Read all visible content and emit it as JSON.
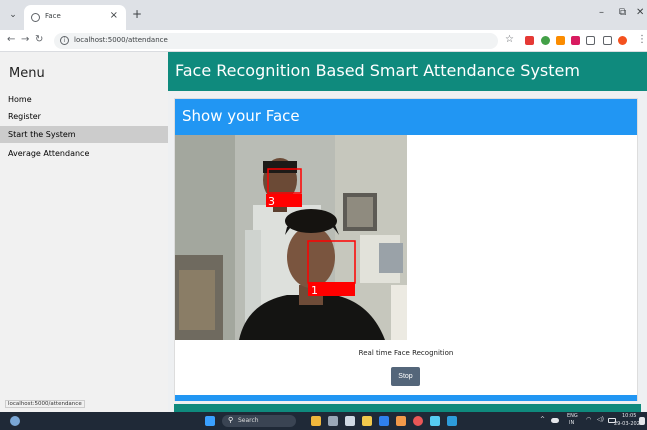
{
  "browser": {
    "tab_title": "Face",
    "tab_close": "×",
    "new_tab": "+",
    "url": "localhost:5000/attendance",
    "status_url": "localhost:5000/attendance"
  },
  "sidebar": {
    "title": "Menu",
    "items": [
      {
        "label": "Home"
      },
      {
        "label": "Register"
      },
      {
        "label": "Start the System"
      },
      {
        "label": "Average Attendance"
      }
    ]
  },
  "header": {
    "title": "Face Recognition Based Smart Attendance System"
  },
  "card": {
    "title": "Show your Face",
    "caption": "Real time Face Recognition",
    "stop_label": "Stop"
  },
  "video": {
    "faces": [
      {
        "label": "3"
      },
      {
        "label": "1"
      }
    ]
  },
  "taskbar": {
    "search_placeholder": "Search",
    "lang_top": "ENG",
    "lang_bottom": "IN",
    "time": "10:05",
    "date": "29-03-2024"
  },
  "colors": {
    "header_teal": "#0f8a7d",
    "card_blue": "#2196f3",
    "stop_button": "#54667a",
    "face_box": "#ff0000"
  }
}
